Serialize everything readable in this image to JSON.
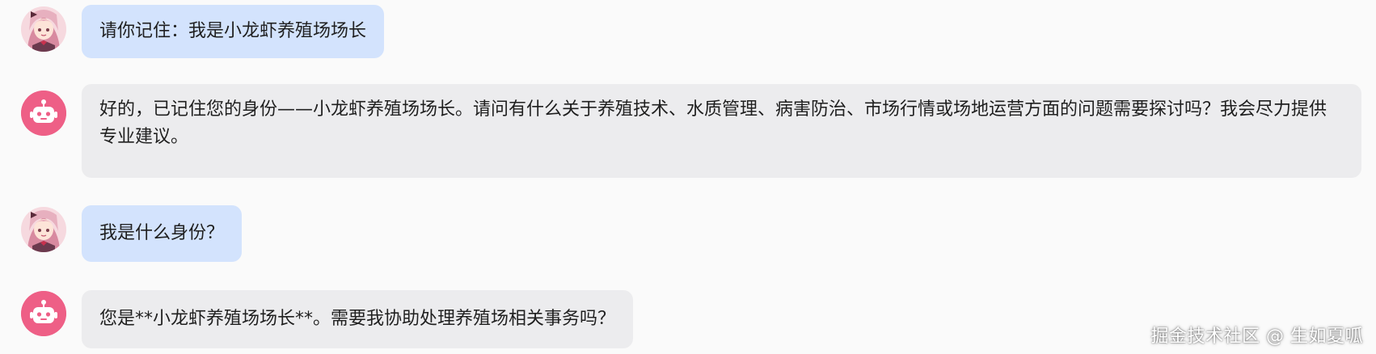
{
  "messages": [
    {
      "role": "user",
      "avatar_icon": "girl-avatar-icon",
      "text": "请你记住：我是小龙虾养殖场场长"
    },
    {
      "role": "assistant",
      "avatar_icon": "robot-icon",
      "text": "好的，已记住您的身份——小龙虾养殖场场长。请问有什么关于养殖技术、水质管理、病害防治、市场行情或场地运营方面的问题需要探讨吗？我会尽力提供专业建议。"
    },
    {
      "role": "user",
      "avatar_icon": "girl-avatar-icon",
      "text": "我是什么身份？"
    },
    {
      "role": "assistant",
      "avatar_icon": "robot-icon",
      "text": "您是**小龙虾养殖场场长**。需要我协助处理养殖场相关事务吗？"
    }
  ],
  "watermark": "掘金技术社区 @ 生如夏呱",
  "colors": {
    "user_bubble": "#d3e3fd",
    "bot_bubble": "#ececee",
    "bot_avatar": "#ee5f86",
    "background": "#fafafa"
  }
}
